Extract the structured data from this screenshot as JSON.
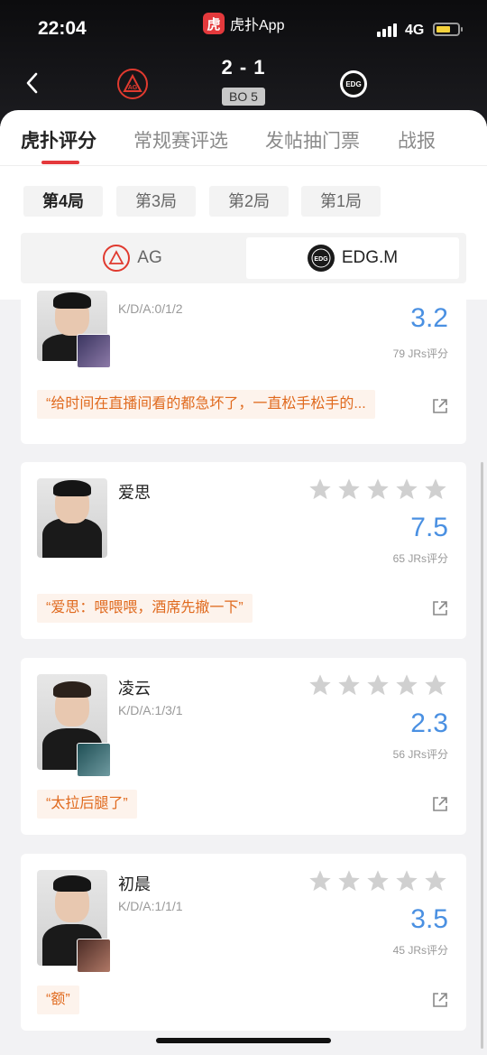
{
  "status": {
    "time": "22:04",
    "network": "4G"
  },
  "app": {
    "name": "虎扑App",
    "logo_char": "虎"
  },
  "match": {
    "score": "2 - 1",
    "format": "BO 5",
    "team_left": "AG",
    "team_right": "EDG.M",
    "team_left_logo_text": "AG",
    "team_right_logo_text": "EDG"
  },
  "tabs": [
    {
      "label": "虎扑评分"
    },
    {
      "label": "常规赛评选"
    },
    {
      "label": "发帖抽门票"
    },
    {
      "label": "战报"
    }
  ],
  "rounds": [
    {
      "label": "第4局"
    },
    {
      "label": "第3局"
    },
    {
      "label": "第2局"
    },
    {
      "label": "第1局"
    }
  ],
  "players": [
    {
      "name": "",
      "kda": "K/D/A:0/1/2",
      "rating": "3.2",
      "rating_value": 3.2,
      "votes": "79 JRs评分",
      "comment": "“给时间在直播间看的都急坏了，一直松手松手的...",
      "stars_filled": 0
    },
    {
      "name": "爱思",
      "kda": "",
      "rating": "7.5",
      "rating_value": 7.5,
      "votes": "65 JRs评分",
      "comment": "“爱思：喂喂喂，酒席先撤一下”",
      "stars_filled": 0
    },
    {
      "name": "凌云",
      "kda": "K/D/A:1/3/1",
      "rating": "2.3",
      "rating_value": 2.3,
      "votes": "56 JRs评分",
      "comment": "“太拉后腿了”",
      "stars_filled": 0
    },
    {
      "name": "初晨",
      "kda": "K/D/A:1/1/1",
      "rating": "3.5",
      "rating_value": 3.5,
      "votes": "45 JRs评分",
      "comment": "“额”",
      "stars_filled": 0
    }
  ],
  "colors": {
    "accent": "#e4393c",
    "rating": "#4a90e2",
    "comment_text": "#e06a1e",
    "comment_bg": "#fdf3ec",
    "star_empty": "#d0d0d0"
  }
}
